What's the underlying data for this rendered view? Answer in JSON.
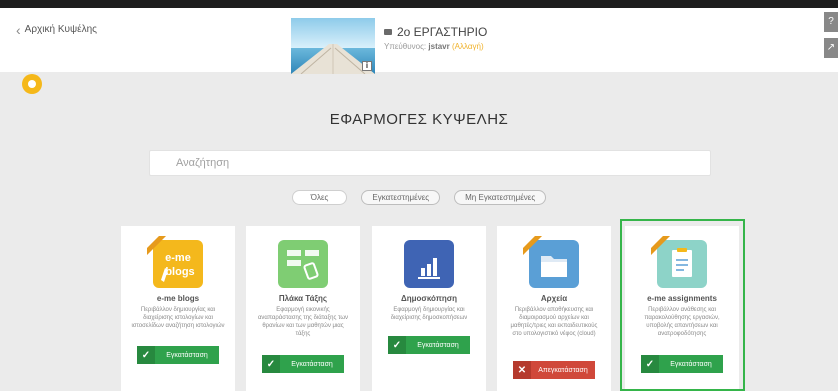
{
  "header": {
    "back_label": "Αρχική Κυψέλης",
    "room_title": "2ο ΕΡΓΑΣΤΗΡΙΟ",
    "owner_prefix": "Υπεύθυνος:",
    "owner_name": "jstavr",
    "owner_change": "(Αλλαγή)",
    "thumb_info": "i",
    "side_tab_top": "?",
    "side_tab_bottom": "↗"
  },
  "page": {
    "title": "ΕΦΑΡΜΟΓΕΣ ΚΥΨΕΛΗΣ"
  },
  "search": {
    "placeholder": "Αναζήτηση"
  },
  "filters": [
    "Όλες",
    "Εγκατεστημένες",
    "Μη Εγκατεστημένες"
  ],
  "apps": [
    {
      "name": "e-me blogs",
      "description": "Περιβάλλον δημιουργίας και διαχείρισης ιστολογίων και ιστοσελίδων αναζήτηση ιστολογιών",
      "button_label": "Εγκατάσταση",
      "button_state": "installed",
      "icon_color": "#f4b81c",
      "icon_name": "blogs-icon",
      "icon_text_1": "e-me",
      "icon_text_2": "blogs",
      "ribbon": true
    },
    {
      "name": "Πλάκα Τάξης",
      "description": "Εφαρμογή εικονικής αναπαράστασης της διάταξης των θρανίων και των μαθητών μιας τάξης",
      "button_label": "Εγκατάσταση",
      "button_state": "installed",
      "icon_color": "#7fcd73",
      "icon_name": "class-board-icon",
      "ribbon": false
    },
    {
      "name": "Δημοσκόπηση",
      "description": "Εφαρμογή δημιουργίας και διαχείρισης δημοσκοπήσεων",
      "button_label": "Εγκατάσταση",
      "button_state": "installed",
      "icon_color": "#3f64b4",
      "icon_name": "poll-chart-icon",
      "ribbon": false
    },
    {
      "name": "Αρχεία",
      "description": "Περιβάλλον αποθήκευσης και διαμοιρασμού αρχείων και μαθητές/τριες και εκπαιδευτικούς στο υπολογιστικό νέφος (cloud)",
      "button_label": "Απεγκατάσταση",
      "button_state": "uninstall",
      "icon_color": "#5a9fd6",
      "icon_name": "folder-icon",
      "ribbon": true
    },
    {
      "name": "e-me assignments",
      "description": "Περιβάλλον ανάθεσης και παρακολούθησης εργασιών, υποβολής απαντήσεων και ανατροφοδότησης",
      "button_label": "Εγκατάσταση",
      "button_state": "installed",
      "icon_color": "#8dd3c8",
      "icon_name": "assignments-icon",
      "ribbon": true
    }
  ],
  "colors": {
    "install_green": "#2fa24c",
    "uninstall_red": "#d0483a",
    "accent_yellow": "#f5b81a",
    "highlight_green": "#35b54a"
  }
}
